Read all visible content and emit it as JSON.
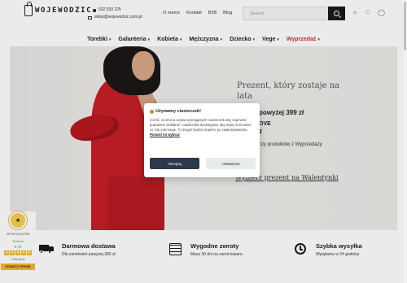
{
  "header": {
    "logo_text": "WOJEWODZIC",
    "phone": "532 533 225",
    "email": "sklep@wojewodzic.com.pl",
    "links": [
      "O marce",
      "Kontakt",
      "B2B",
      "Blog"
    ],
    "search_placeholder": "Search",
    "icons": [
      "user-icon",
      "heart-icon",
      "cart-icon"
    ]
  },
  "nav": {
    "items": [
      {
        "label": "Torebki",
        "chevron": true
      },
      {
        "label": "Galanteria",
        "chevron": true
      },
      {
        "label": "Kobieta",
        "chevron": true
      },
      {
        "label": "Mężczyzna",
        "chevron": true
      },
      {
        "label": "Dziecko",
        "chevron": true
      },
      {
        "label": "Vege",
        "chevron": true
      },
      {
        "label": "Wyprzedaż",
        "chevron": true,
        "sale": true
      }
    ]
  },
  "hero": {
    "title": "Prezent, który zostaje na lata",
    "line1": "powyżej 399 zł",
    "line2": "OVE",
    "line3": "2",
    "line4": "czy produktów z Wyprzedaży",
    "cta": "Wybierz prezent na Walentynki"
  },
  "cookie": {
    "title": "Używamy ciasteczek!",
    "body": "Cześć, ta strona używa wymaganych ciasteczek aby zapewnić poprawne działanie i ciasteczka trackingowe aby lepiej zrozumieć co Cię interesuje. To drugie będzie dopiero po zaakceptowaniu.",
    "link": "Pozwól mi wybrać",
    "accept": "Akceptuj",
    "settings": "Ustawienia"
  },
  "reviews": {
    "label": "OPINIE KLIENTÓW",
    "word": "Świetne",
    "score": "9.76",
    "stars": 5,
    "count": "7438 opinii",
    "button": "ZOBACZ OPINIE"
  },
  "features": [
    {
      "title": "Darmowa dostawa",
      "sub": "Dla zamówień powyżej 300 zł",
      "icon": "truck-icon"
    },
    {
      "title": "Wygodne zwroty",
      "sub": "Masz 30 dni na zwrot towaru",
      "icon": "calendar-icon"
    },
    {
      "title": "Szybka wysyłka",
      "sub": "Wysyłamy w 24 godziny",
      "icon": "clock-icon"
    }
  ],
  "colors": {
    "accent": "#2b3a4a",
    "sale": "#c0392b",
    "dress": "#c61f26"
  }
}
